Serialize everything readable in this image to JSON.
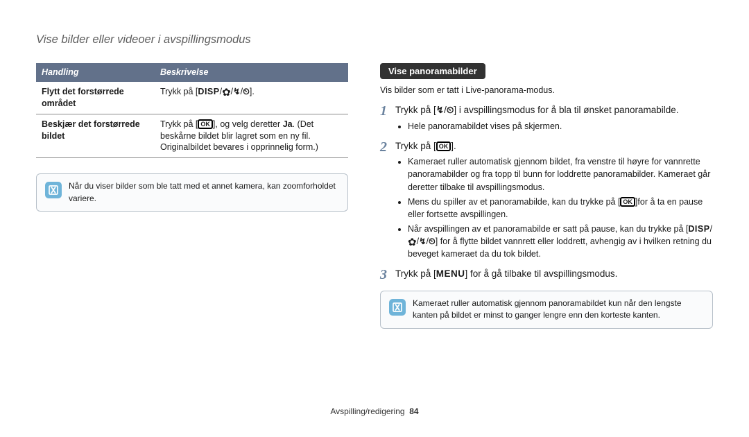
{
  "title": "Vise bilder eller videoer i avspillingsmodus",
  "table": {
    "headers": {
      "col1": "Handling",
      "col2": "Beskrivelse"
    },
    "row1": {
      "action": "Flytt det forstørrede området",
      "pre": "Trykk på [",
      "slash": "/",
      "post": "]."
    },
    "row2": {
      "action": "Beskjær det forstørrede bildet",
      "pre": "Trykk på [",
      "mid": "], og velg deretter ",
      "ja": "Ja",
      "rest": ". (Det beskårne bildet blir lagret som en ny fil. Originalbildet bevares i opprinnelig form.)"
    }
  },
  "glyphs": {
    "disp": "DISP",
    "ok": "OK",
    "menu": "MENU",
    "flash": "↯",
    "timer": "⏲",
    "flower": "✿"
  },
  "note_left": "Når du viser bilder som ble tatt med et annet kamera, kan zoomforholdet variere.",
  "right": {
    "heading": "Vise panoramabilder",
    "intro": "Vis bilder som er tatt i Live-panorama-modus.",
    "step1": {
      "a": "Trykk på [",
      "slash": "/",
      "b": "] i avspillingsmodus for å bla til ønsket panoramabilde.",
      "sub1": "Hele panoramabildet vises på skjermen."
    },
    "step2": {
      "a": "Trykk på [",
      "b": "].",
      "sub1": "Kameraet ruller automatisk gjennom bildet, fra venstre til høyre for vannrette panoramabilder og fra topp til bunn for loddrette panoramabilder. Kameraet går deretter tilbake til avspillingsmodus.",
      "sub2a": "Mens du spiller av et panoramabilde, kan du trykke på [",
      "sub2b": "]for å ta en pause eller fortsette avspillingen.",
      "sub3a": "Når avspillingen av et panoramabilde er satt på pause, kan du trykke på [",
      "slash": "/",
      "sub3b": "] for å flytte bildet vannrett eller loddrett, avhengig av i hvilken retning du beveget kameraet da du tok bildet."
    },
    "step3": {
      "a": "Trykk på [",
      "b": "] for å gå tilbake til avspillingsmodus."
    },
    "note": "Kameraet ruller automatisk gjennom panoramabildet kun når den lengste kanten på bildet er minst to ganger lengre enn den korteste kanten."
  },
  "footer": {
    "section": "Avspilling/redigering",
    "page": "84"
  }
}
